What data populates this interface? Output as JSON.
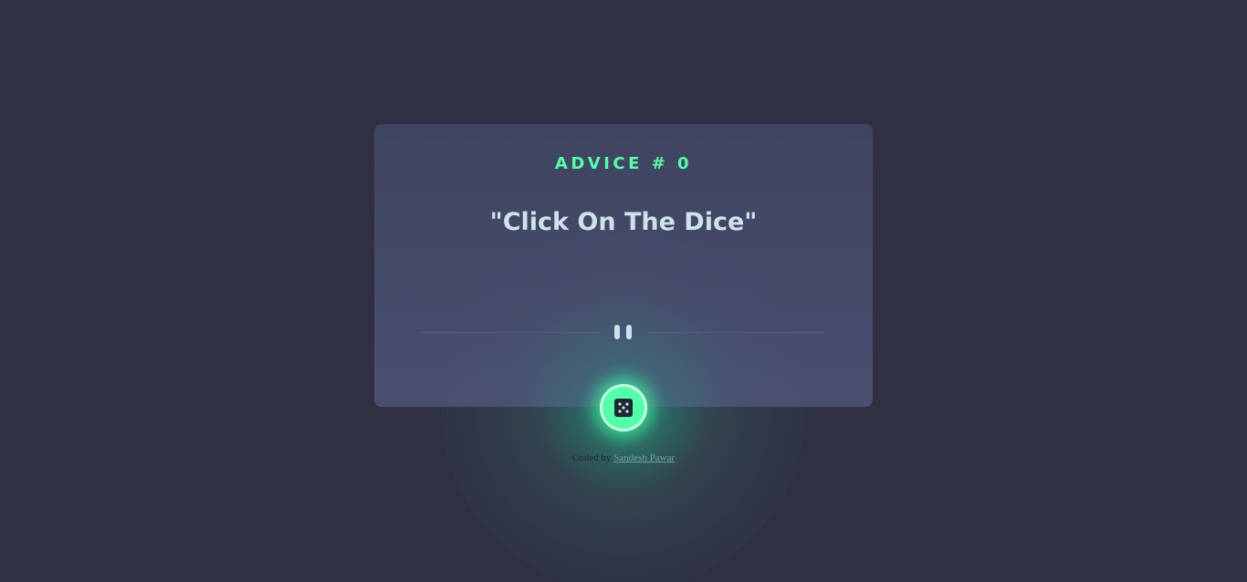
{
  "advice": {
    "label": "ADVICE # 0",
    "quote": "\"Click On The Dice\""
  },
  "dice_button": {
    "icon": "dice-icon"
  },
  "divider": {
    "icon": "pause-icon"
  },
  "attribution": {
    "prefix": "Coded by",
    "author": "Sandesh Pawar"
  },
  "colors": {
    "background": "#2f3142",
    "card": "#4a4f70",
    "accent": "#52ffa8",
    "text": "#cee3e9",
    "divider": "#56607a"
  }
}
